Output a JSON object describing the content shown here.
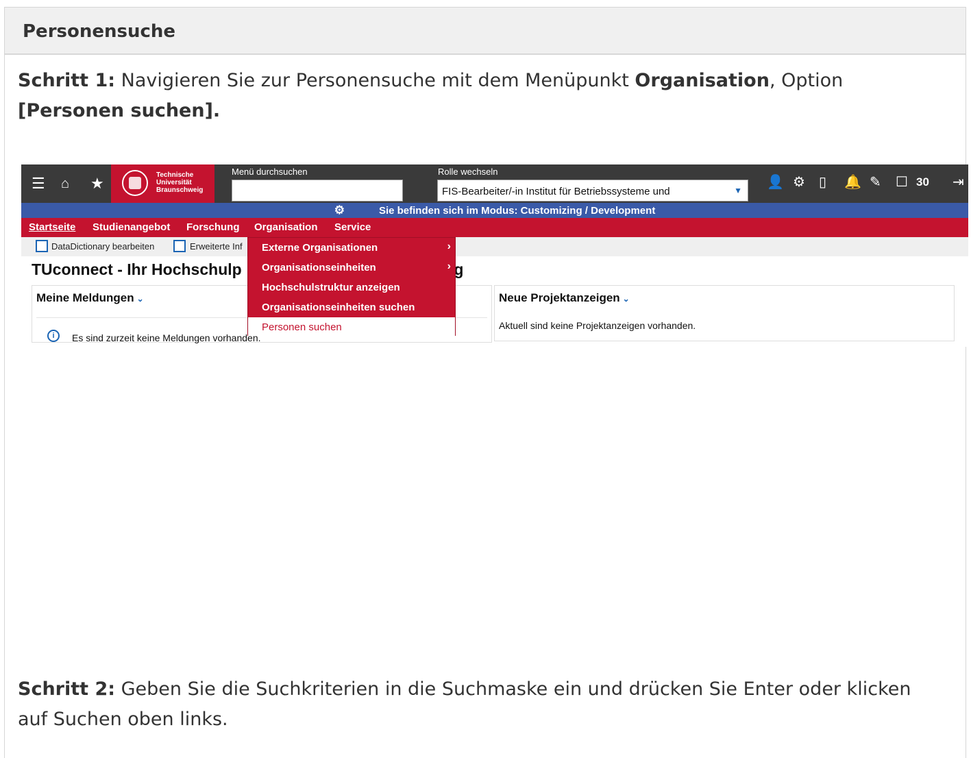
{
  "section": {
    "title": "Personensuche"
  },
  "step1": {
    "prefix": "Schritt 1:",
    "text1": " Navigieren Sie zur Personensuche mit dem Menüpunkt ",
    "bold_menu": "Organisation",
    "text2": ", Option ",
    "bold_option": "[Personen suchen]."
  },
  "step2": {
    "prefix": "Schritt 2:",
    "text": " Geben Sie die Suchkriterien in die Suchmaske ein und drücken Sie Enter oder klicken auf Suchen oben links."
  },
  "app": {
    "logo_lines": [
      "Technische",
      "Universität",
      "Braunschweig"
    ],
    "search_label": "Menü durchsuchen",
    "search_value": "",
    "role_label": "Rolle wechseln",
    "role_value": "FIS-Bearbeiter/-in Institut für Betriebssysteme und",
    "counter": "30",
    "mode_text": "Sie befinden sich im Modus: Customizing / Development",
    "menu": [
      "Startseite",
      "Studienangebot",
      "Forschung",
      "Organisation",
      "Service"
    ],
    "toolbar": {
      "datadictionary": "DataDictionary bearbeiten",
      "erweiterte": "Erweiterte Inf"
    },
    "page_title": "TUconnect - Ihr Hochschulp",
    "page_title_tail": "ig",
    "panel_left": {
      "title": "Meine Meldungen",
      "text": "Es sind zurzeit keine Meldungen vorhanden."
    },
    "panel_right": {
      "title": "Neue Projektanzeigen",
      "text": "Aktuell sind keine Projektanzeigen vorhanden."
    },
    "dropdown": [
      {
        "label": "Externe Organisationen",
        "submenu": true
      },
      {
        "label": "Organisationseinheiten",
        "submenu": true
      },
      {
        "label": "Hochschulstruktur anzeigen",
        "submenu": false
      },
      {
        "label": "Organisationseinheiten suchen",
        "submenu": false
      },
      {
        "label": "Personen suchen",
        "submenu": false
      }
    ]
  }
}
